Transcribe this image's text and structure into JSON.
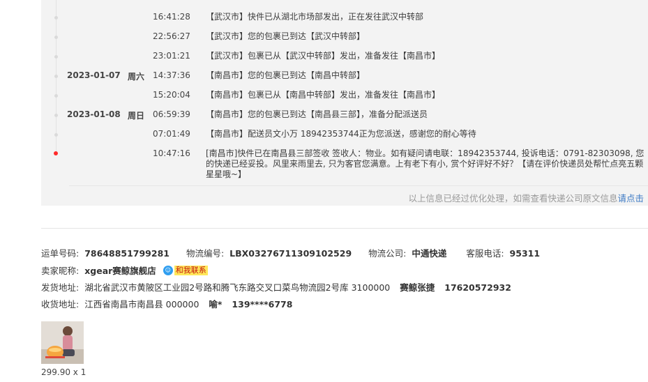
{
  "tracking": {
    "events": [
      {
        "date": "",
        "weekday": "",
        "time": "16:41:28",
        "desc": "【武汉市】快件已从湖北市场部发出，正在发往武汉中转部"
      },
      {
        "date": "",
        "weekday": "",
        "time": "22:56:27",
        "desc": "【武汉市】您的包裹已到达【武汉中转部】"
      },
      {
        "date": "",
        "weekday": "",
        "time": "23:01:21",
        "desc": "【武汉市】包裹已从【武汉中转部】发出，准备发往【南昌市】"
      },
      {
        "date": "2023-01-07",
        "weekday": "周六",
        "time": "14:37:36",
        "desc": "【南昌市】您的包裹已到达【南昌中转部】"
      },
      {
        "date": "",
        "weekday": "",
        "time": "15:20:04",
        "desc": "【南昌市】包裹已从【南昌中转部】发出，准备发往【南昌市】"
      },
      {
        "date": "2023-01-08",
        "weekday": "周日",
        "time": "06:59:39",
        "desc": "【南昌市】您的包裹已到达【南昌县三部】，准备分配派送员"
      },
      {
        "date": "",
        "weekday": "",
        "time": "07:01:49",
        "desc": "【南昌市】配送员文小万 18942353744正为您派送，感谢您的耐心等待"
      },
      {
        "date": "",
        "weekday": "",
        "time": "10:47:16",
        "desc": "[南昌市]快件已在南昌县三部签收 签收人：物业。如有疑问请电联：18942353744, 投诉电话：0791-82303098, 您的快递已经妥投。风里来雨里去, 只为客官您满意。上有老下有小, 赏个好评好不好？【请在评价快递员处帮忙点亮五颗星星哦~】",
        "current": true
      }
    ],
    "optimize_note": "以上信息已经过优化处理，如需查看快递公司原文信息",
    "optimize_link": "请点击"
  },
  "order": {
    "waybill_label": "运单号码:",
    "waybill_no": "78648851799281",
    "logistics_label": "物流编号:",
    "logistics_no": "LBX03276711309102529",
    "company_label": "物流公司:",
    "company": "中通快递",
    "phone_label": "客服电话:",
    "phone": "95311",
    "seller_label": "卖家昵称:",
    "seller": "xgear赛鲸旗舰店",
    "contact_label": "和我联系",
    "ship_label": "发货地址:",
    "ship_address": "湖北省武汉市黄陂区工业园2号路和腾飞东路交叉口菜鸟物流园2号库 3100000",
    "ship_name": "赛鲸张捷",
    "ship_phone": "17620572932",
    "recv_label": "收货地址:",
    "recv_address": "江西省南昌市南昌县 000000",
    "recv_name": "喻*",
    "recv_phone": "139****6778"
  },
  "product": {
    "thumb_icon": "product-thumbnail",
    "price_qty": "299.90 x 1"
  },
  "colors": {
    "panel_bg": "#f3f3f3",
    "current_dot": "#ff2a2a",
    "link": "#3d7ac4",
    "contact_bg": "#ffe85a",
    "contact_text": "#c4130f"
  }
}
